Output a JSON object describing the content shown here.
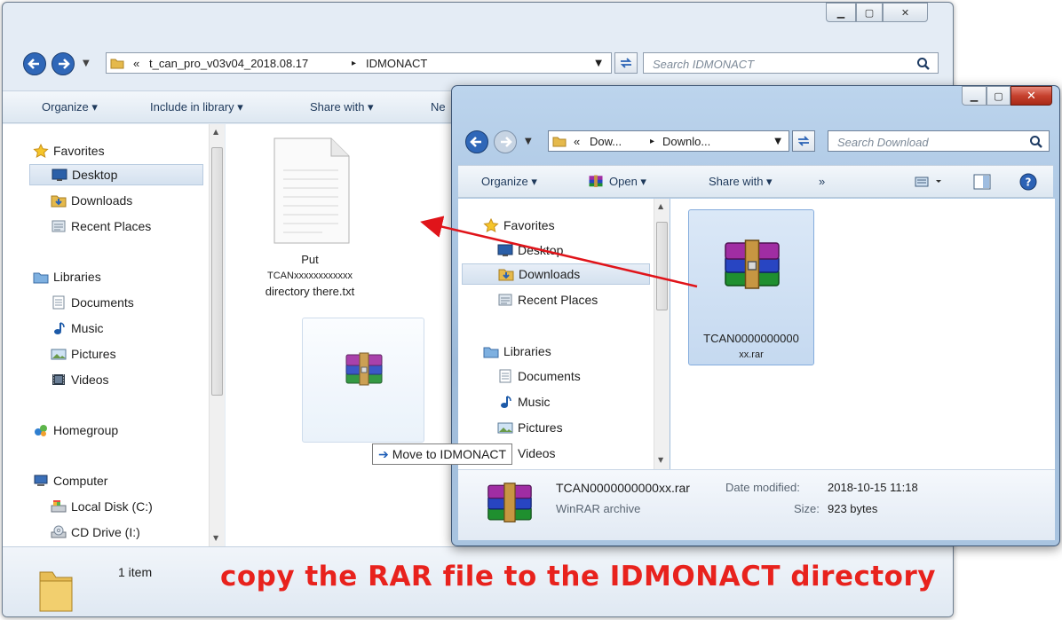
{
  "back_window": {
    "address_crumbs": [
      "«",
      "t_can_pro_v03v04_2018.08.17",
      "▸",
      "IDMONACT"
    ],
    "search_placeholder": "Search IDMONACT",
    "toolbar": {
      "organize": "Organize ▾",
      "include": "Include in library ▾",
      "share": "Share with ▾",
      "new": "Ne"
    },
    "nav": {
      "favorites": "Favorites",
      "desktop": "Desktop",
      "downloads": "Downloads",
      "recent": "Recent Places",
      "libraries": "Libraries",
      "documents": "Documents",
      "music": "Music",
      "pictures": "Pictures",
      "videos": "Videos",
      "homegroup": "Homegroup",
      "computer": "Computer",
      "local_disk": "Local Disk (C:)",
      "cd_drive": "CD Drive (I:)"
    },
    "files": [
      {
        "name_lines": [
          "Put",
          "TCANxxxxxxxxxxxx",
          "directory there.txt"
        ],
        "icon": "text-file-icon"
      }
    ],
    "status": "1 item"
  },
  "front_window": {
    "address_crumbs": [
      "«",
      "Dow...",
      "▸",
      "Downlo..."
    ],
    "search_placeholder": "Search Download",
    "toolbar": {
      "organize": "Organize ▾",
      "open": "Open ▾",
      "share": "Share with ▾",
      "more": "»"
    },
    "nav": {
      "favorites": "Favorites",
      "desktop": "Desktop",
      "downloads": "Downloads",
      "recent": "Recent Places",
      "libraries": "Libraries",
      "documents": "Documents",
      "music": "Music",
      "pictures": "Pictures",
      "videos": "Videos"
    },
    "files": [
      {
        "name_lines": [
          "TCAN0000000000",
          "xx.rar"
        ],
        "icon": "rar-archive-icon"
      }
    ],
    "details": {
      "filename": "TCAN0000000000xx.rar",
      "type": "WinRAR archive",
      "modified_label": "Date modified:",
      "modified_value": "2018-10-15 11:18",
      "size_label": "Size:",
      "size_value": "923 bytes"
    }
  },
  "drag_tooltip": "Move to IDMONACT",
  "caption": "copy the RAR file to the IDMONACT directory",
  "colors": {
    "caption": "#e8221d",
    "arrow": "#e0141a",
    "window_frame": "#bcd4ed",
    "close_button": "#c6412e"
  }
}
